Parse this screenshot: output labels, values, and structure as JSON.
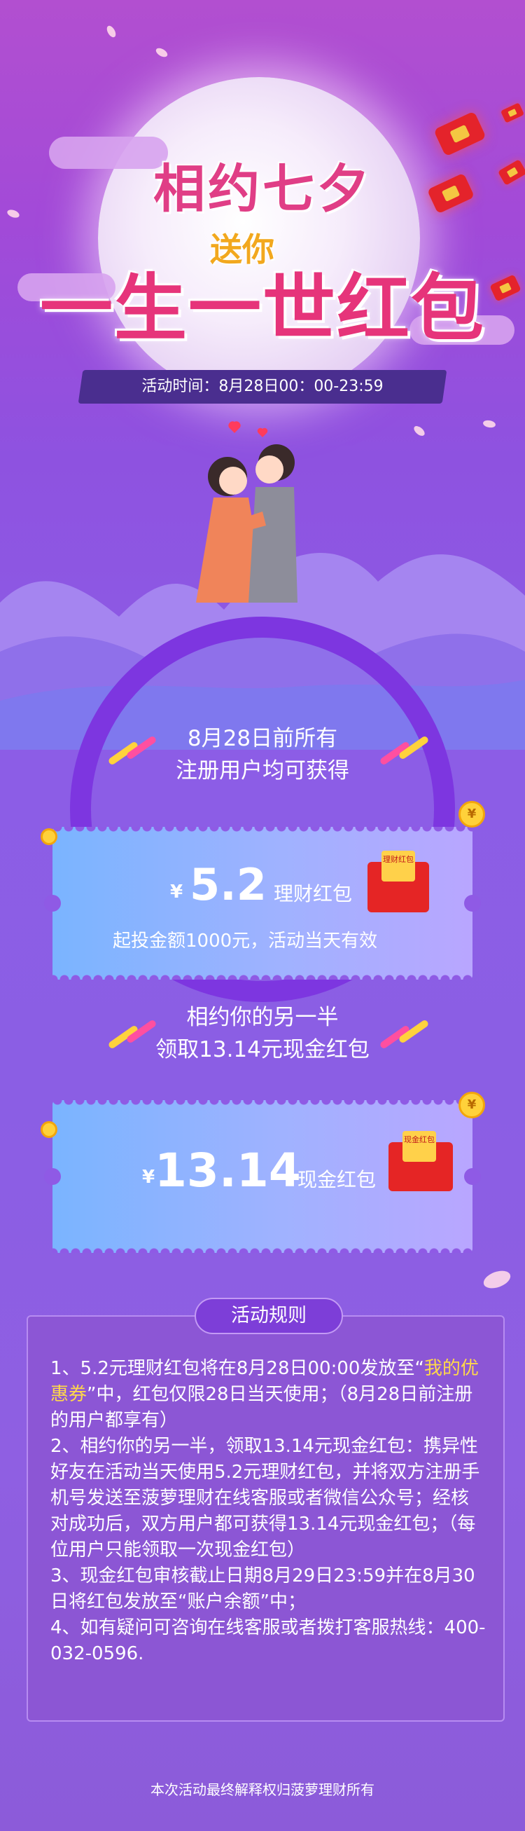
{
  "header": {
    "title_line1": "相约七夕",
    "title_small": "送你",
    "title_line2": "一生一世红包",
    "activity_time": "活动时间：8月28日00：00-23:59"
  },
  "section1": {
    "line1": "8月28日前所有",
    "line2": "注册用户均可获得"
  },
  "coupon1": {
    "currency": "¥",
    "amount": "5.2",
    "label": "理财红包",
    "note": "起投金额1000元，活动当天有效",
    "envelope_text": "理财红包"
  },
  "section2": {
    "line1": "相约你的另一半",
    "line2": "领取13.14元现金红包"
  },
  "coupon2": {
    "currency": "¥",
    "amount": "13.14",
    "label": "现金红包",
    "envelope_text": "现金红包"
  },
  "coin_symbol": "¥",
  "rules": {
    "tag": "活动规则",
    "item1_pre": "1、5.2元理财红包将在8月28日00:00发放至“",
    "item1_hl": "我的优惠券",
    "item1_post": "”中，红包仅限28日当天使用；（8月28日前注册的用户都享有）",
    "item2": "2、相约你的另一半，领取13.14元现金红包：携异性好友在活动当天使用5.2元理财红包，并将双方注册手机号发送至菠萝理财在线客服或者微信公众号；经核对成功后，双方用户都可获得13.14元现金红包；（每位用户只能领取一次现金红包）",
    "item3": "3、现金红包审核截止日期8月29日23:59并在8月30日将红包发放至“账户余额”中；",
    "item4": "4、如有疑问可咨询在线客服或者拨打客服热线：400-032-0596."
  },
  "footer": "本次活动最终解释权归菠萝理财所有",
  "colors": {
    "title_pink": "#e6347a",
    "accent_orange": "#f2a81e",
    "banner_dark": "#4a2e8f",
    "highlight": "#ffd84a"
  }
}
